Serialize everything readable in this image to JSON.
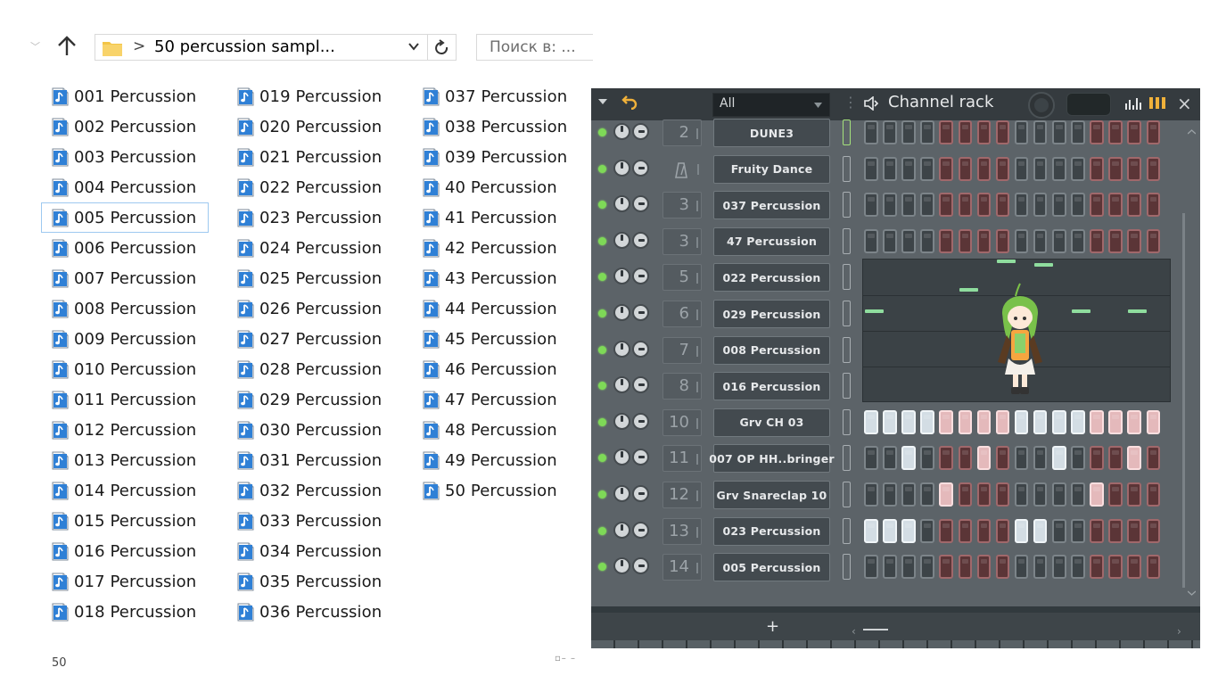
{
  "explorer": {
    "address_sep": ">",
    "address_text": "50 percussion sampl...",
    "search_placeholder": "Поиск в: ...",
    "status_count": "50",
    "view_glyphs": "▫– –",
    "selected_file": "005 Percussion",
    "columns": [
      [
        "001 Percussion",
        "002 Percussion",
        "003 Percussion",
        "004 Percussion",
        "005 Percussion",
        "006 Percussion",
        "007 Percussion",
        "008 Percussion",
        "009 Percussion",
        "010 Percussion",
        "011 Percussion",
        "012 Percussion",
        "013 Percussion",
        "014 Percussion",
        "015 Percussion",
        "016 Percussion",
        "017 Percussion",
        "018 Percussion"
      ],
      [
        "019 Percussion",
        "020 Percussion",
        "021 Percussion",
        "022 Percussion",
        "023 Percussion",
        "024 Percussion",
        "025 Percussion",
        "026 Percussion",
        "027 Percussion",
        "028 Percussion",
        "029 Percussion",
        "030 Percussion",
        "031 Percussion",
        "032 Percussion",
        "033 Percussion",
        "034 Percussion",
        "035 Percussion",
        "036 Percussion"
      ],
      [
        "037 Percussion",
        "038 Percussion",
        "039 Percussion",
        "40 Percussion",
        "41 Percussion",
        "42 Percussion",
        "43 Percussion",
        "44 Percussion",
        "45 Percussion",
        "46 Percussion",
        "47 Percussion",
        "48 Percussion",
        "49 Percussion",
        "50 Percussion"
      ]
    ]
  },
  "rack": {
    "filter": "All",
    "title": "Channel rack",
    "close": "×",
    "add_channel": "+",
    "channels": [
      {
        "num": "2",
        "name": "DUNE3",
        "mode": "steps",
        "mixer_active": true,
        "steps": [
          "g",
          "g",
          "g",
          "g",
          "r",
          "r",
          "r",
          "r",
          "g",
          "g",
          "g",
          "g",
          "r",
          "r",
          "r",
          "r"
        ],
        "on": []
      },
      {
        "num": "",
        "name": "Fruity Dance",
        "mode": "steps",
        "icon": "metronome",
        "steps": [
          "g",
          "g",
          "g",
          "g",
          "r",
          "r",
          "r",
          "r",
          "g",
          "g",
          "g",
          "g",
          "r",
          "r",
          "r",
          "r"
        ],
        "on": []
      },
      {
        "num": "3",
        "name": "037 Percussion",
        "mode": "steps",
        "steps": [
          "g",
          "g",
          "g",
          "g",
          "r",
          "r",
          "r",
          "r",
          "g",
          "g",
          "g",
          "g",
          "r",
          "r",
          "r",
          "r"
        ],
        "on": []
      },
      {
        "num": "3",
        "name": "47 Percussion",
        "mode": "steps",
        "steps": [
          "g",
          "g",
          "g",
          "g",
          "r",
          "r",
          "r",
          "r",
          "g",
          "g",
          "g",
          "g",
          "r",
          "r",
          "r",
          "r"
        ],
        "on": []
      },
      {
        "num": "5",
        "name": "022 Percussion",
        "mode": "piano"
      },
      {
        "num": "6",
        "name": "029 Percussion",
        "mode": "piano"
      },
      {
        "num": "7",
        "name": "008 Percussion",
        "mode": "piano"
      },
      {
        "num": "8",
        "name": "016 Percussion",
        "mode": "piano"
      },
      {
        "num": "10",
        "name": "Grv CH 03",
        "mode": "steps",
        "steps": [
          "g",
          "g",
          "g",
          "g",
          "r",
          "r",
          "r",
          "r",
          "g",
          "g",
          "g",
          "g",
          "r",
          "r",
          "r",
          "r"
        ],
        "on": [
          0,
          1,
          2,
          3,
          4,
          5,
          6,
          7,
          8,
          9,
          10,
          11,
          12,
          13,
          14,
          15
        ]
      },
      {
        "num": "11",
        "name": "007 OP HH..bringer",
        "mode": "steps",
        "steps": [
          "g",
          "g",
          "g",
          "g",
          "r",
          "r",
          "r",
          "r",
          "g",
          "g",
          "g",
          "g",
          "r",
          "r",
          "r",
          "r"
        ],
        "on": [
          2,
          6,
          10,
          14
        ]
      },
      {
        "num": "12",
        "name": "Grv Snareclap 10",
        "mode": "steps",
        "steps": [
          "g",
          "g",
          "g",
          "g",
          "r",
          "r",
          "r",
          "r",
          "g",
          "g",
          "g",
          "g",
          "r",
          "r",
          "r",
          "r"
        ],
        "on": [
          4,
          12
        ]
      },
      {
        "num": "13",
        "name": "023 Percussion",
        "mode": "steps",
        "steps": [
          "g",
          "g",
          "g",
          "g",
          "r",
          "r",
          "r",
          "r",
          "g",
          "g",
          "g",
          "g",
          "r",
          "r",
          "r",
          "r"
        ],
        "on": [
          0,
          1,
          2,
          8,
          9
        ]
      },
      {
        "num": "14",
        "name": "005 Percussion",
        "mode": "steps",
        "steps": [
          "g",
          "g",
          "g",
          "g",
          "r",
          "r",
          "r",
          "r",
          "g",
          "g",
          "g",
          "g",
          "r",
          "r",
          "r",
          "r"
        ],
        "on": []
      }
    ],
    "piano_notes": [
      {
        "row": 0,
        "step": 7.0,
        "len": 1
      },
      {
        "row": 0,
        "step": 9.0,
        "len": 1
      },
      {
        "row": 0,
        "step": 5.0,
        "len": 1
      },
      {
        "row": 1,
        "step": 0.0,
        "len": 1
      },
      {
        "row": 1,
        "step": 11.0,
        "len": 1
      },
      {
        "row": 1,
        "step": 14.0,
        "len": 1
      }
    ],
    "colors": {
      "led": "#7ed957",
      "step_on_grey": "#d3dde4",
      "step_on_red": "#e4b9bb",
      "note": "#8fdd9e"
    }
  }
}
